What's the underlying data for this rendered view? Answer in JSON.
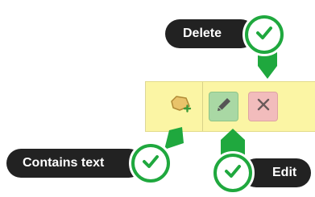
{
  "callouts": {
    "delete": {
      "label": "Delete"
    },
    "contains_text": {
      "label": "Contains text"
    },
    "edit": {
      "label": "Edit"
    }
  },
  "toolbar": {
    "buttons": [
      {
        "name": "contains-text",
        "icon": "tag-add-icon"
      },
      {
        "name": "edit",
        "icon": "pencil-icon"
      },
      {
        "name": "delete",
        "icon": "close-icon"
      }
    ]
  },
  "colors": {
    "toolbar_bg": "#fbf5a4",
    "edit_bg": "#a9d8a4",
    "delete_bg": "#f2bcbc",
    "callout_pill": "#222222",
    "badge_green": "#1fa83e"
  }
}
